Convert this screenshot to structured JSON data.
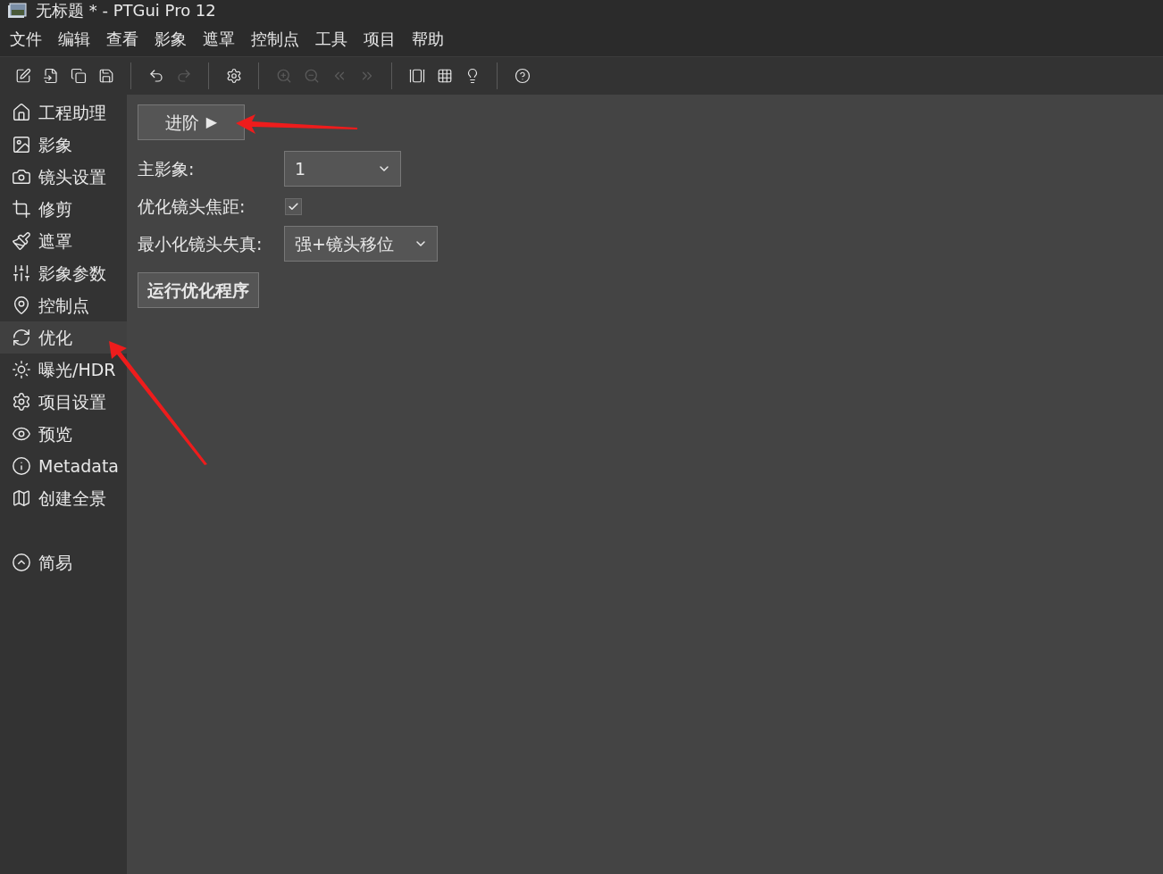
{
  "window": {
    "title": "无标题 * - PTGui Pro 12"
  },
  "menu": [
    "文件",
    "编辑",
    "查看",
    "影象",
    "遮罩",
    "控制点",
    "工具",
    "项目",
    "帮助"
  ],
  "toolbar": [
    {
      "disabled": false
    },
    {
      "disabled": false
    },
    {
      "disabled": false
    },
    {
      "disabled": false
    },
    {
      "disabled": false
    },
    {
      "disabled": true
    },
    {
      "disabled": false
    },
    {
      "disabled": true
    },
    {
      "disabled": true
    },
    {
      "disabled": true
    },
    {
      "disabled": true
    },
    {
      "disabled": false
    },
    {
      "disabled": false
    },
    {
      "disabled": false
    },
    {
      "disabled": false
    }
  ],
  "sidebar": {
    "items": [
      {
        "label": "工程助理",
        "selected": false
      },
      {
        "label": "影象",
        "selected": false
      },
      {
        "label": "镜头设置",
        "selected": false
      },
      {
        "label": "修剪",
        "selected": false
      },
      {
        "label": "遮罩",
        "selected": false
      },
      {
        "label": "影象参数",
        "selected": false
      },
      {
        "label": "控制点",
        "selected": false
      },
      {
        "label": "优化",
        "selected": true
      },
      {
        "label": "曝光/HDR",
        "selected": false
      },
      {
        "label": "项目设置",
        "selected": false
      },
      {
        "label": "预览",
        "selected": false
      },
      {
        "label": "Metadata",
        "selected": false
      },
      {
        "label": "创建全景",
        "selected": false
      }
    ],
    "simple": {
      "label": "简易"
    }
  },
  "panel": {
    "advanced_button": {
      "label": "进阶",
      "arrow": "▶"
    },
    "fields": [
      {
        "kind": "select",
        "label": "主影象:",
        "value": "1"
      },
      {
        "kind": "checkbox",
        "label": "优化镜头焦距:",
        "checked": true
      },
      {
        "kind": "select",
        "label": "最小化镜头失真:",
        "value": "强+镜头移位"
      }
    ],
    "run_button": {
      "label": "运行优化程序"
    }
  }
}
